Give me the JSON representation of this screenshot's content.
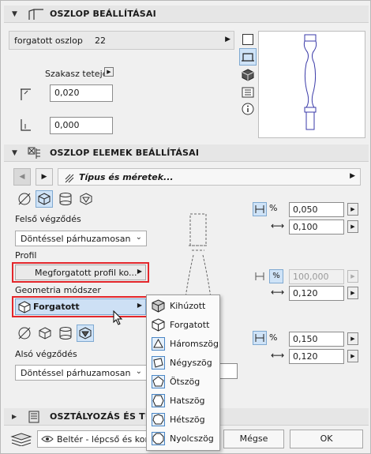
{
  "sections": {
    "post_settings": "OSZLOP BEÁLLÍTÁSAI",
    "post_elements": "OSZLOP ELEMEK BEÁLLÍTÁSAI",
    "classification": "OSZTÁLYOZÁS ÉS TULAJ"
  },
  "post_selector": {
    "name": "forgatott oszlop",
    "value": "22"
  },
  "segment_top": {
    "label": "Szakasz teteje",
    "top_value": "0,020",
    "bottom_value": "0,000"
  },
  "element_nav": {
    "title": "Típus és méretek..."
  },
  "upper": {
    "label": "Felső végződés",
    "value": "Döntéssel párhuzamosan",
    "pct_value": "0,050",
    "len_value": "0,100"
  },
  "profile": {
    "label": "Profil",
    "value": "Megforgatott profil ko...",
    "pct_value": "100,000",
    "len_value": "0,120"
  },
  "geometry": {
    "label": "Geometria módszer",
    "value": "Forgatott"
  },
  "lower": {
    "label": "Alsó végződés",
    "value": "Döntéssel párhuzamosan",
    "pct_value": "0,150",
    "len_value": "0,120"
  },
  "pct_symbol": "%",
  "menu": {
    "items": [
      "Kihúzott",
      "Forgatott",
      "Háromszög",
      "Négyszög",
      "Ötszög",
      "Hatszög",
      "Hétszög",
      "Nyolcszög"
    ]
  },
  "footer": {
    "layer": "Beltér - lépcső és korlá",
    "cancel": "Mégse",
    "ok": "OK"
  },
  "colors": {
    "accent": "#cfe3f7",
    "highlight_border": "#e3262b",
    "dropdown_blue": "#cde0f5"
  }
}
